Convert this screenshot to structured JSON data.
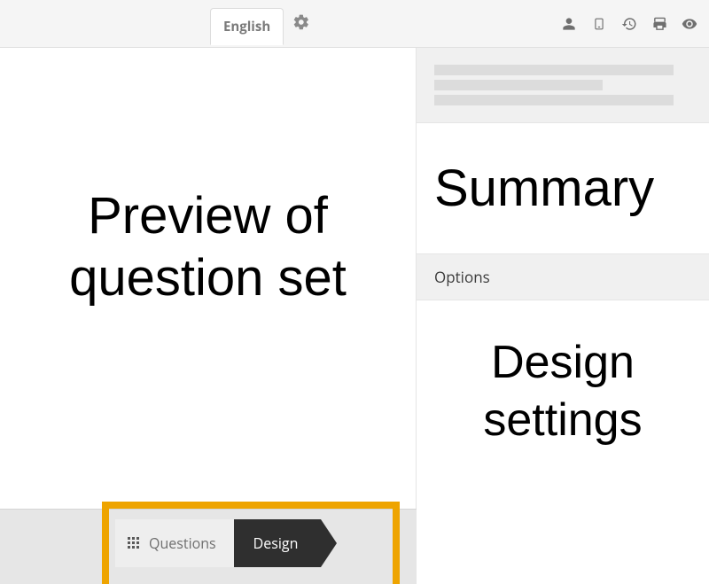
{
  "topbar": {
    "language_label": "English"
  },
  "main": {
    "preview_heading": "Preview of question set"
  },
  "right": {
    "summary_heading": "Summary",
    "options_label": "Options",
    "design_settings_heading": "Design settings"
  },
  "tabs": {
    "questions_label": "Questions",
    "design_label": "Design"
  }
}
